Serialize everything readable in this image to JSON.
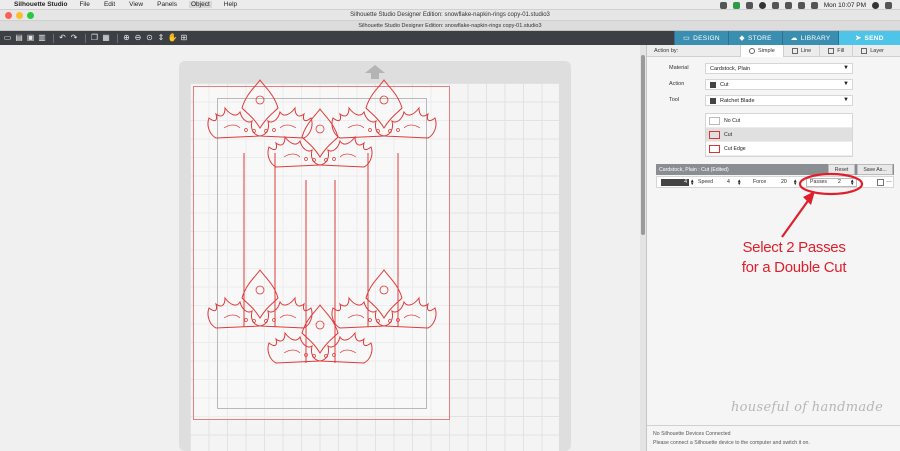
{
  "menubar": {
    "app_name": "Silhouette Studio",
    "items": [
      "File",
      "Edit",
      "View",
      "Panels",
      "Object",
      "Help"
    ],
    "active_item": "Object",
    "clock": "Mon 10:07 PM"
  },
  "window": {
    "title": "Silhouette Studio Designer Edition: snowflake-napkin-rings copy-01.studio3",
    "subtitle": "Silhouette Studio Designer Edition: snowflake-napkin-rings copy-01.studio3"
  },
  "toolbar": {
    "tabs": {
      "design": "DESIGN",
      "store": "STORE",
      "library": "LIBRARY",
      "send": "SEND"
    },
    "active_tab": "send"
  },
  "panel": {
    "action_by_label": "Action by:",
    "modes": {
      "simple": "Simple",
      "line": "Line",
      "fill": "Fill",
      "layer": "Layer"
    },
    "active_mode": "simple",
    "material_label": "Material",
    "material_value": "Cardstock, Plain",
    "action_label": "Action",
    "action_value": "Cut",
    "tool_label": "Tool",
    "tool_value": "Ratchet Blade",
    "action_options": [
      "No Cut",
      "Cut",
      "Cut Edge"
    ],
    "selected_action_option": "Cut",
    "settings_header": "Cardstock, Plain : Cut (Edited)",
    "reset_label": "Reset",
    "save_as_label": "Save As...",
    "blade_value": "4",
    "speed_label": "Speed",
    "speed_value": "4",
    "force_label": "Force",
    "force_value": "20",
    "passes_label": "Passes",
    "passes_value": "2",
    "status_line_1": "No Silhouette Devices Connected",
    "status_line_2": "Please connect a Silhouette device to the computer and switch it on."
  },
  "annotation": {
    "callout_line_1": "Select 2 Passes",
    "callout_line_2": "for a Double Cut",
    "highlight_color": "#e01f2d"
  },
  "watermark": "houseful of handmade",
  "colors": {
    "cut_line": "#e03a3a",
    "send_tab": "#4ec4e8",
    "tab_bar": "#3a8fb0",
    "toolbar_bg": "#3c3f44"
  }
}
